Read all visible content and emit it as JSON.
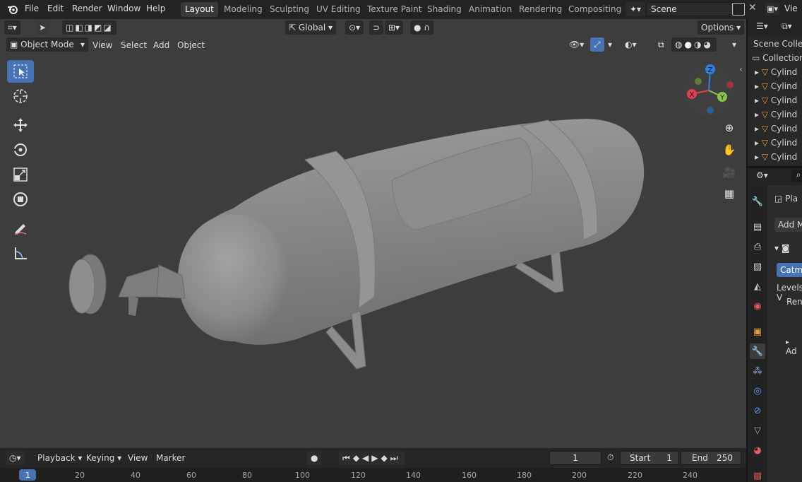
{
  "menu": [
    "File",
    "Edit",
    "Render",
    "Window",
    "Help"
  ],
  "workspaces": [
    {
      "label": "Layout",
      "active": true
    },
    {
      "label": "Modeling",
      "active": false
    },
    {
      "label": "Sculpting",
      "active": false
    },
    {
      "label": "UV Editing",
      "active": false
    },
    {
      "label": "Texture Paint",
      "active": false
    },
    {
      "label": "Shading",
      "active": false
    },
    {
      "label": "Animation",
      "active": false
    },
    {
      "label": "Rendering",
      "active": false
    },
    {
      "label": "Compositing",
      "active": false
    }
  ],
  "scene": {
    "name": "Scene",
    "view_layer": "Vie"
  },
  "viewport_header": {
    "mode": "Object Mode",
    "menus": [
      "View",
      "Select",
      "Add",
      "Object"
    ],
    "transform_orientation": "Global",
    "options_label": "Options"
  },
  "outliner": {
    "title": "Scene Collect",
    "collection": "Collection",
    "items": [
      "Cylind",
      "Cylind",
      "Cylind",
      "Cylind",
      "Cylind",
      "Cylind",
      "Cylind"
    ]
  },
  "properties": {
    "object_name": "Pla",
    "add_modifier": "Add Mo",
    "subdiv_type": "Catmu",
    "levels_label": "Levels V",
    "render_label": "Rend",
    "advanced_label": "Ad"
  },
  "gizmo": {
    "x": "X",
    "y": "Y",
    "z": "Z"
  },
  "timeline": {
    "menus": [
      "Playback",
      "Keying",
      "View",
      "Marker"
    ],
    "current_frame": "1",
    "start_label": "Start",
    "start_value": "1",
    "end_label": "End",
    "end_value": "250",
    "ruler": [
      "1",
      "20",
      "40",
      "60",
      "80",
      "100",
      "120",
      "140",
      "160",
      "180",
      "200",
      "220",
      "240"
    ]
  },
  "colors": {
    "accent": "#4772b3",
    "x_axis": "#e0404f",
    "y_axis": "#8bc34a",
    "z_axis": "#2f7fe0",
    "object_orange": "#e8a13a"
  }
}
